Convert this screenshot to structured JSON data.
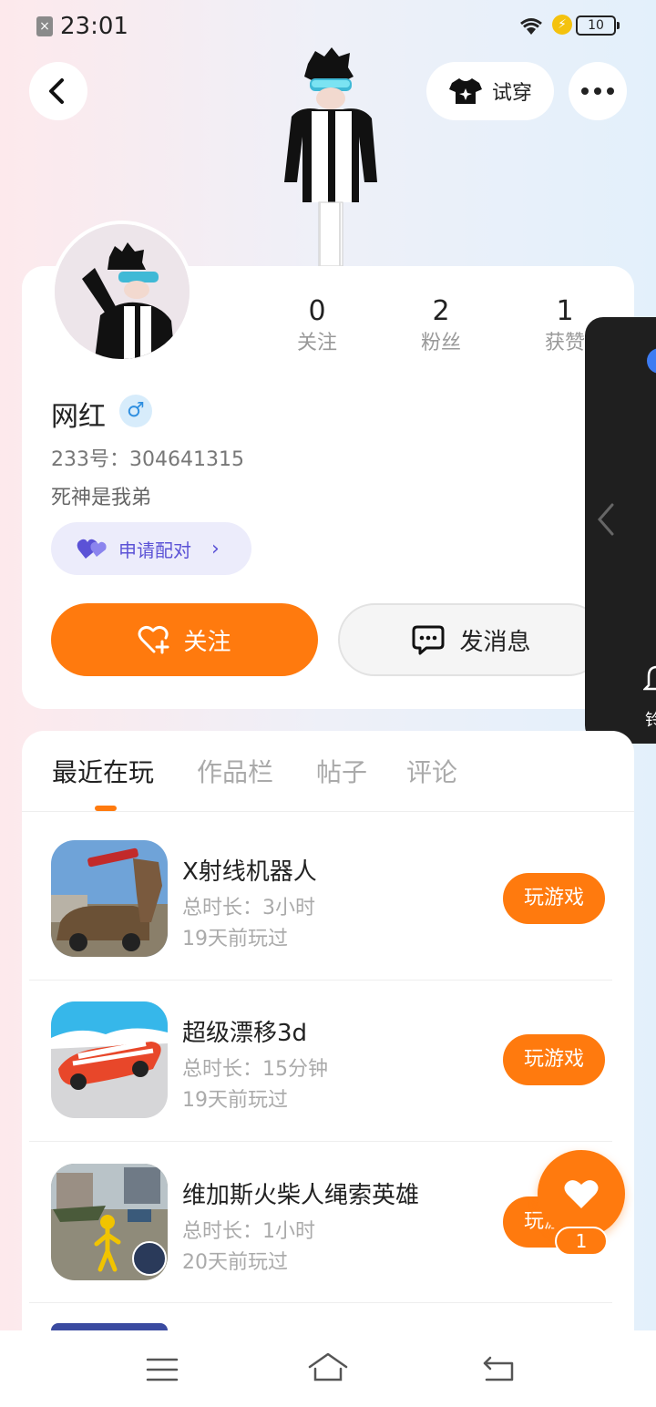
{
  "status_bar": {
    "time": "23:01",
    "battery": "10"
  },
  "top_nav": {
    "tryon_label": "试穿"
  },
  "profile": {
    "stats": [
      {
        "value": "0",
        "label": "关注"
      },
      {
        "value": "2",
        "label": "粉丝"
      },
      {
        "value": "1",
        "label": "获赞"
      }
    ],
    "username": "网红",
    "gender_symbol": "♂",
    "user_id": "233号：304641315",
    "bio": "死神是我弟",
    "pair_label": "申请配对",
    "follow_label": "关注",
    "message_label": "发消息"
  },
  "side_panel": {
    "bell_label": "铃"
  },
  "tabs": [
    {
      "label": "最近在玩",
      "active": true
    },
    {
      "label": "作品栏",
      "active": false
    },
    {
      "label": "帖子",
      "active": false
    },
    {
      "label": "评论",
      "active": false
    }
  ],
  "games": [
    {
      "title": "X射线机器人",
      "duration": "总时长：3小时",
      "last_played": "19天前玩过",
      "button": "玩游戏"
    },
    {
      "title": "超级漂移3d",
      "duration": "总时长：15分钟",
      "last_played": "19天前玩过",
      "button": "玩游戏"
    },
    {
      "title": "维加斯火柴人绳索英雄",
      "duration": "总时长：1小时",
      "last_played": "20天前玩过",
      "button": "玩游戏"
    }
  ],
  "like": {
    "count": "1"
  },
  "colors": {
    "accent": "#ff7a0e",
    "pair": "#5b52d6"
  }
}
